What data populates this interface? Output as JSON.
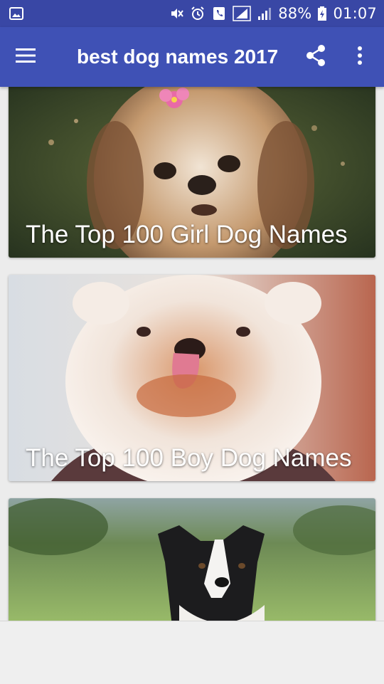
{
  "status_bar": {
    "battery": "88%",
    "time": "01:07",
    "icons": [
      "image-icon",
      "mute-icon",
      "alarm-icon",
      "phone-signal-icon",
      "signal-icon",
      "battery-icon"
    ]
  },
  "toolbar": {
    "title": "best dog names 2017",
    "menu_icon": "hamburger-menu-icon",
    "share_icon": "share-icon",
    "overflow_icon": "more-vertical-icon",
    "color": "#3f51b5",
    "status_color": "#3947a5"
  },
  "cards": [
    {
      "title": "The Top 100 Girl Dog Names"
    },
    {
      "title": "The Top 100 Boy Dog Names"
    },
    {
      "title": ""
    }
  ]
}
